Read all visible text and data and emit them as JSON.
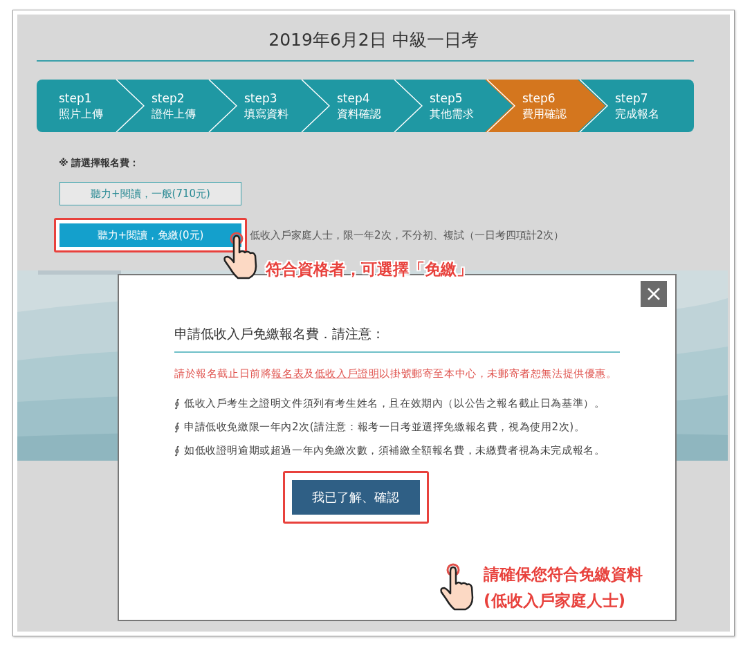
{
  "title": "2019年6月2日 中級一日考",
  "steps": [
    {
      "number": "step1",
      "label": "照片上傳",
      "selected": false
    },
    {
      "number": "step2",
      "label": "證件上傳",
      "selected": false
    },
    {
      "number": "step3",
      "label": "填寫資料",
      "selected": false
    },
    {
      "number": "step4",
      "label": "資料確認",
      "selected": false
    },
    {
      "number": "step5",
      "label": "其他需求",
      "selected": false
    },
    {
      "number": "step6",
      "label": "費用確認",
      "selected": true
    },
    {
      "number": "step7",
      "label": "完成報名",
      "selected": false
    }
  ],
  "fee_prompt": "※ 請選擇報名費：",
  "fee_options": [
    {
      "label": "聽力+閱讀，一般(710元)",
      "selected": false,
      "highlighted": false
    },
    {
      "label": "聽力+閱讀，免繳(0元)",
      "selected": true,
      "highlighted": true,
      "note": "低收入戶家庭人士，限一年2次，不分初、複試（一日考四項計2次）"
    }
  ],
  "callout_top": [
    "符合資格者，可選擇「免繳」"
  ],
  "dialog": {
    "heading": "申請低收入戶免繳報名費．請注意：",
    "notice": [
      {
        "text": "請於報名截止日前將",
        "link": false
      },
      {
        "text": "報名表",
        "link": true
      },
      {
        "text": "及",
        "link": false
      },
      {
        "text": "低收入戶證明",
        "link": true
      },
      {
        "text": "以掛號郵寄至本中心，未郵寄者恕無法提供優惠。",
        "link": false
      }
    ],
    "bullet": "∮",
    "items": [
      "低收入戶考生之證明文件須列有考生姓名，且在效期內（以公告之報名截止日為基準）。",
      "申請低收免繳限一年內2次(請注意：報考一日考並選擇免繳報名費，視為使用2次)。",
      "如低收證明逾期或超過一年內免繳次數，須補繳全額報名費，未繳費者視為未完成報名。"
    ],
    "confirm_button": "我已了解、確認",
    "confirm_highlighted": true
  },
  "callout_bottom": [
    "請確保您符合免繳資料",
    "(低收入戶家庭人士)"
  ]
}
